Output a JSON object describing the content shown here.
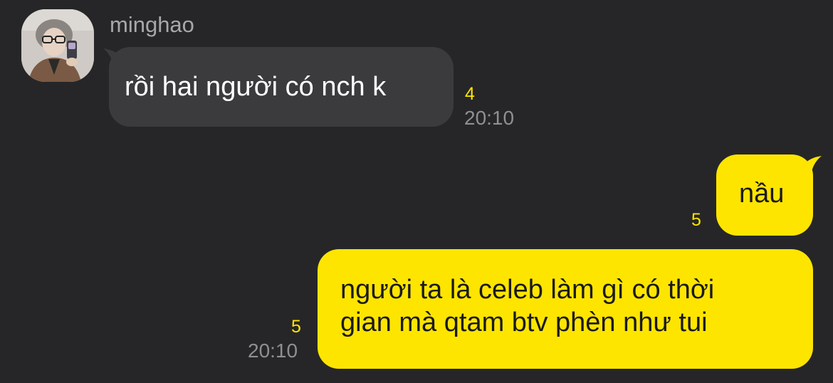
{
  "conversation": {
    "sender_name": "minghao",
    "messages": [
      {
        "direction": "incoming",
        "text": "rồi hai người có nch k",
        "unread_count": "4",
        "time": "20:10"
      },
      {
        "direction": "outgoing",
        "text": "nầu",
        "unread_count": "5",
        "time": ""
      },
      {
        "direction": "outgoing",
        "lines": [
          "người ta là celeb làm gì có thời",
          "gian mà qtam btv phèn như tui"
        ],
        "unread_count": "5",
        "time": "20:10"
      }
    ]
  },
  "colors": {
    "background": "#262628",
    "incoming_bubble": "#3b3b3d",
    "outgoing_bubble": "#fee500",
    "unread_count": "#fee500",
    "timestamp": "#8f8f8f",
    "sender_name": "#a8a8a8"
  }
}
